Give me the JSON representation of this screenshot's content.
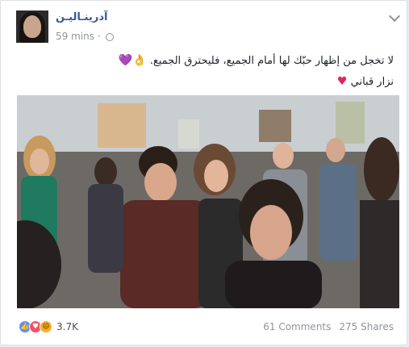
{
  "post": {
    "author": "آدرينـاليـن",
    "time": "59 mins",
    "separator": "·",
    "text_line1": "لا تخجل من إظهار حبّك لها أمام الجميع، فليحترق الجميع.",
    "emoji_line1": "👌💜",
    "text_line2": "نزار قباني",
    "emoji_line2": "♥"
  },
  "footer": {
    "reaction_count": "3.7K",
    "comments": "61 Comments",
    "shares": "275 Shares"
  },
  "icons": [
    "chevron-down-icon",
    "globe-icon",
    "like-reaction-icon",
    "love-reaction-icon",
    "haha-reaction-icon"
  ],
  "colors": {
    "author_link": "#365899",
    "meta_gray": "#90949c",
    "like": "#5890ff",
    "love": "#f25268",
    "haha": "#f7b125"
  }
}
